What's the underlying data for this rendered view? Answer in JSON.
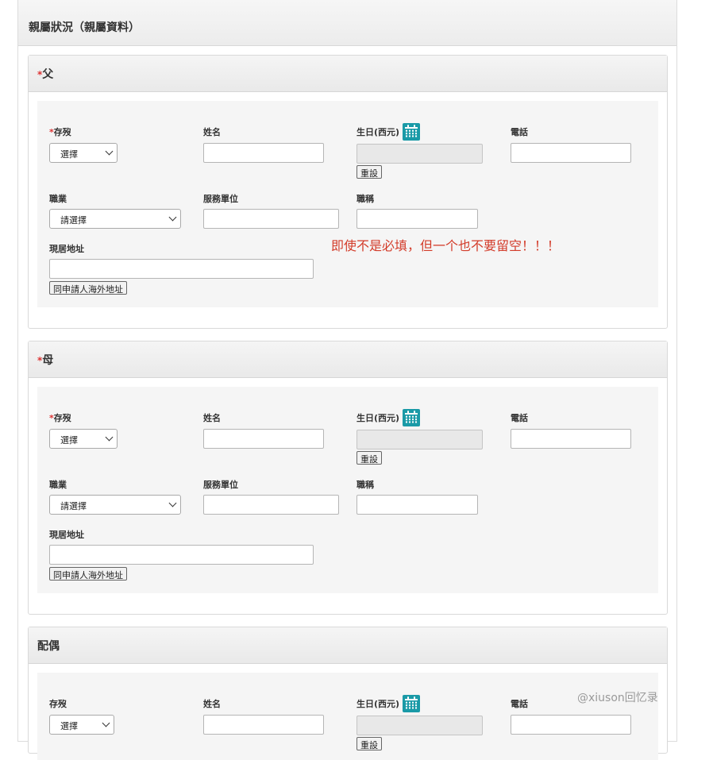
{
  "section_title": "親屬狀況（親屬資料）",
  "note": "即使不是必填，但一个也不要留空！！！",
  "watermark": "@xiuson回忆录",
  "labels": {
    "status": "存歿",
    "name": "姓名",
    "birthday": "生日(西元)",
    "phone": "電話",
    "occupation": "職業",
    "employer": "服務單位",
    "job_title": "職稱",
    "address": "現居地址"
  },
  "buttons": {
    "reset": "重設",
    "same_address": "同申請人海外地址"
  },
  "selects": {
    "status_default": "選擇",
    "occupation_default": "請選擇"
  },
  "panels": [
    {
      "required_mark": "*",
      "title": "父"
    },
    {
      "required_mark": "*",
      "title": "母"
    },
    {
      "required_mark": "",
      "title": "配偶"
    }
  ]
}
